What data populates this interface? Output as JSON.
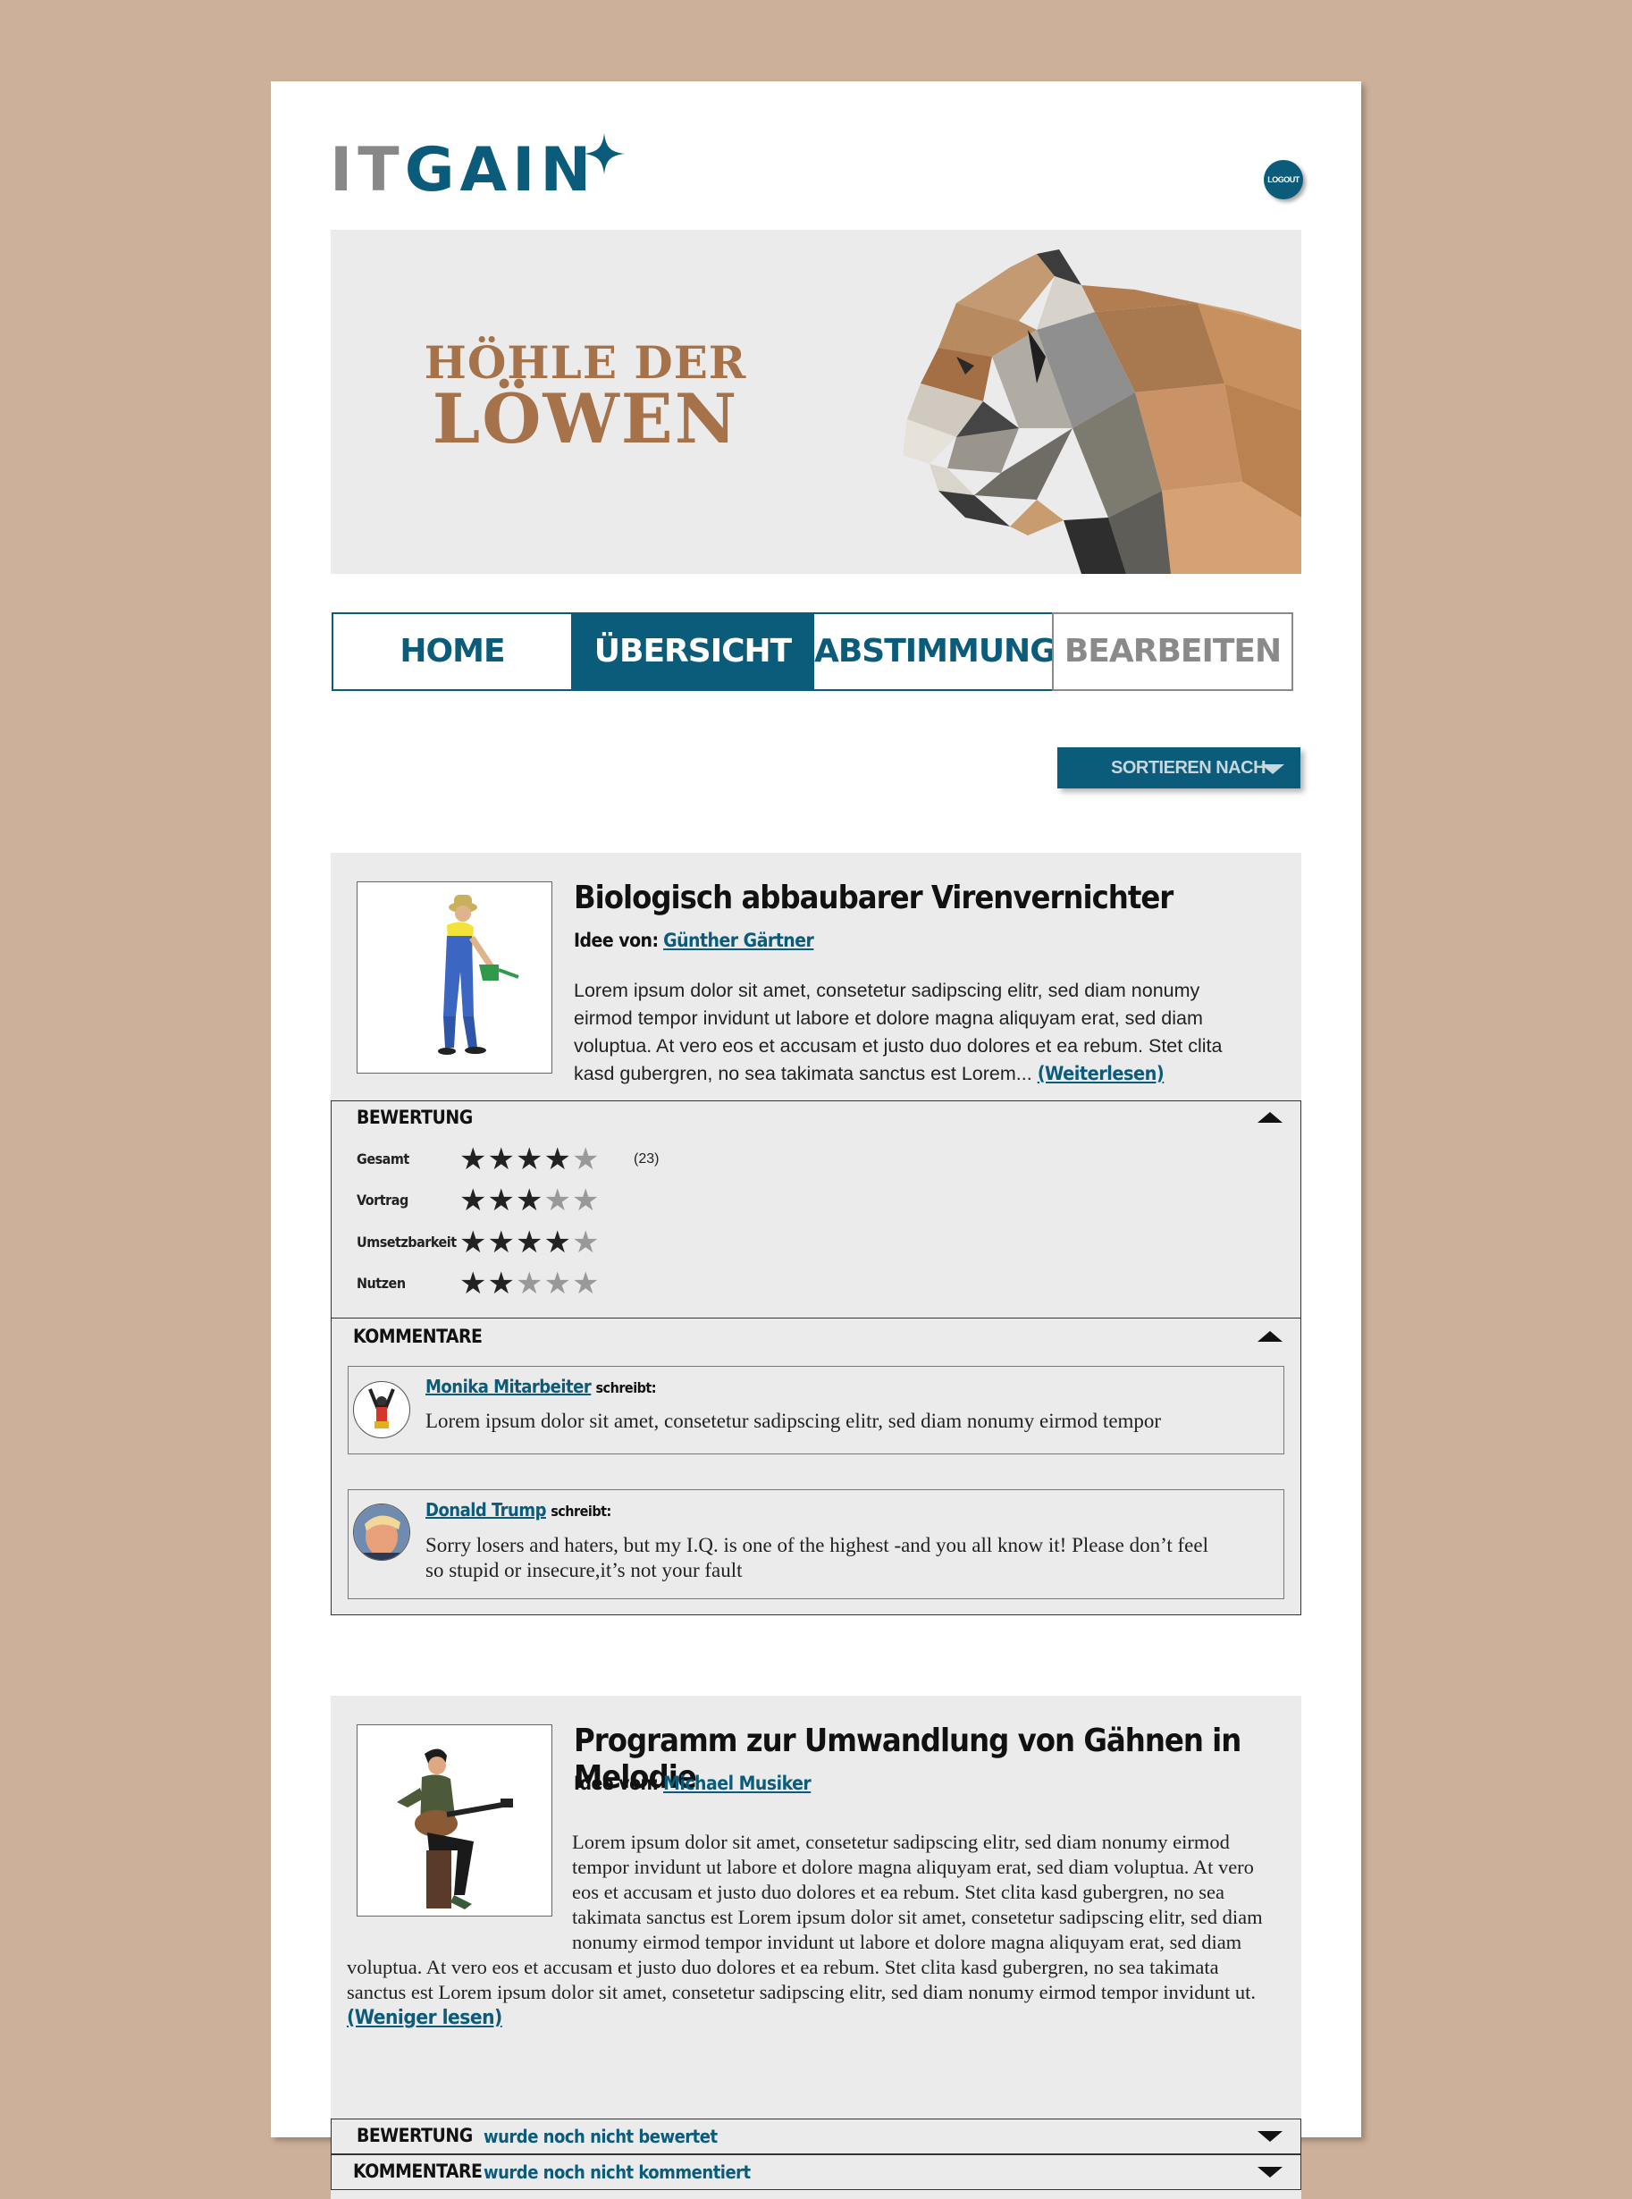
{
  "header": {
    "logo_it": "IT",
    "logo_gain": "GAIN",
    "logout_label": "LOGOUT"
  },
  "banner": {
    "line1": "HÖHLE DER",
    "line2": "LÖWEN"
  },
  "nav": {
    "tabs": [
      {
        "label": "HOME",
        "state": "normal"
      },
      {
        "label": "ÜBERSICHT",
        "state": "active"
      },
      {
        "label": "ABSTIMMUNG",
        "state": "normal"
      },
      {
        "label": "BEARBEITEN",
        "state": "disabled"
      }
    ]
  },
  "sort": {
    "label": "SORTIEREN NACH"
  },
  "ideas": [
    {
      "title": "Biologisch abbaubarer Virenvernichter",
      "author_label": "Idee von:",
      "author": "Günther Gärtner",
      "description": "Lorem ipsum dolor sit amet, consetetur sadipscing elitr, sed diam nonumy eirmod tempor invidunt ut labore et dolore magna aliquyam erat, sed diam voluptua. At vero eos et accusam et justo duo dolores et ea rebum. Stet clita kasd gubergren, no sea takimata sanctus est Lorem...",
      "more_link": "(Weiterlesen)",
      "rating_header": "BEWERTUNG",
      "ratings": [
        {
          "label": "Gesamt",
          "stars": 4,
          "count": "(23)"
        },
        {
          "label": "Vortrag",
          "stars": 3
        },
        {
          "label": "Umsetzbarkeit",
          "stars": 4
        },
        {
          "label": "Nutzen",
          "stars": 2
        }
      ],
      "comments_header": "KOMMENTARE",
      "comments": [
        {
          "author": "Monika Mitarbeiter",
          "verb": "schreibt:",
          "text": "Lorem ipsum dolor sit amet, consetetur sadipscing elitr, sed diam nonumy eirmod tempor"
        },
        {
          "author": "Donald Trump",
          "verb": "schreibt:",
          "text": "Sorry losers and haters, but my I.Q. is one of the highest -and you all know it! Please don’t feel so stupid or insecure,it’s not your fault"
        }
      ]
    },
    {
      "title": "Programm zur Umwandlung von Gähnen in Melodie",
      "author_label": "Idee von:",
      "author": "Michael Musiker",
      "description": "Lorem ipsum dolor sit amet, consetetur sadipscing elitr, sed diam nonumy eirmod tempor invidunt ut labore et dolore magna aliquyam erat, sed diam voluptua. At vero eos et accusam et justo duo dolores et ea rebum. Stet clita kasd gubergren, no sea takimata sanctus est Lorem ipsum dolor sit amet, consetetur sadipscing elitr, sed diam nonumy eirmod tempor invidunt ut labore et dolore magna aliquyam erat, sed diam voluptua. At vero eos et accusam et justo duo dolores et ea rebum. Stet clita kasd gubergren, no sea takimata sanctus est Lorem ipsum dolor sit amet, consetetur sadipscing elitr, sed diam nonumy eirmod tempor invidunt ut.",
      "more_link": "(Weniger lesen)",
      "rating_header": "BEWERTUNG",
      "rating_note": "wurde noch nicht bewertet",
      "comments_header": "KOMMENTARE",
      "comments_note": "wurde noch nicht kommentiert"
    }
  ],
  "colors": {
    "brand": "#0b5b7a",
    "background": "#cdb09a",
    "banner_text": "#a6724a",
    "card": "#ebebeb"
  }
}
